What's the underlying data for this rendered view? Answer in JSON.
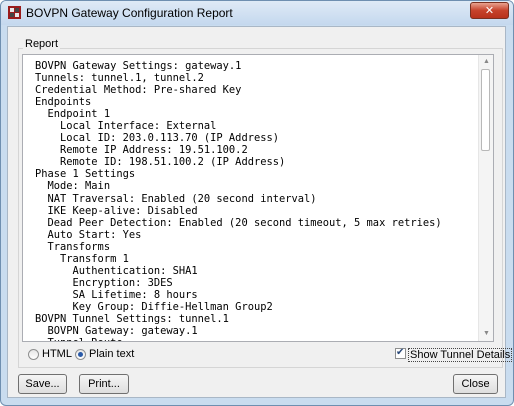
{
  "window": {
    "title": "BOVPN Gateway Configuration Report",
    "close_label": "✕"
  },
  "report": {
    "group_label": "Report",
    "lines": [
      "BOVPN Gateway Settings: gateway.1",
      "Tunnels: tunnel.1, tunnel.2",
      "Credential Method: Pre-shared Key",
      "Endpoints",
      "  Endpoint 1",
      "    Local Interface: External",
      "    Local ID: 203.0.113.70 (IP Address)",
      "    Remote IP Address: 19.51.100.2",
      "    Remote ID: 198.51.100.2 (IP Address)",
      "Phase 1 Settings",
      "  Mode: Main",
      "  NAT Traversal: Enabled (20 second interval)",
      "  IKE Keep-alive: Disabled",
      "  Dead Peer Detection: Enabled (20 second timeout, 5 max retries)",
      "  Auto Start: Yes",
      "  Transforms",
      "    Transform 1",
      "      Authentication: SHA1",
      "      Encryption: 3DES",
      "      SA Lifetime: 8 hours",
      "      Key Group: Diffie-Hellman Group2",
      "BOVPN Tunnel Settings: tunnel.1",
      "  BOVPN Gateway: gateway.1",
      "  Tunnel Route"
    ]
  },
  "format": {
    "html_label": "HTML",
    "plain_label": "Plain text",
    "selected": "Plain text"
  },
  "options": {
    "show_tunnel_details_label": "Show Tunnel Details",
    "show_tunnel_details_checked": true
  },
  "buttons": {
    "save": "Save...",
    "print": "Print...",
    "close": "Close"
  },
  "icons": {
    "app": "firebox-app-icon",
    "close": "close-icon",
    "scroll_up": "scroll-up-arrow-icon",
    "scroll_down": "scroll-down-arrow-icon",
    "check": "check-mark-icon"
  },
  "colors": {
    "close_button": "#c6422b",
    "title_bar": "#c4d8ee",
    "radio_dot": "#2a5aa8"
  }
}
